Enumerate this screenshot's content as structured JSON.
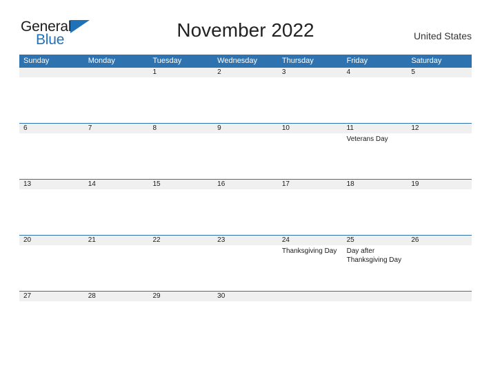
{
  "brand": {
    "line1": "General",
    "line2": "Blue",
    "triangle_color": "#2071b8",
    "text_color": "#1c1c1c"
  },
  "header": {
    "title": "November 2022",
    "country": "United States"
  },
  "theme": {
    "header_blue": "#2e73b0",
    "date_strip": "#f0f0f0",
    "rule_blue": "#2e73b0",
    "page_background": "#ffffff"
  },
  "calendar": {
    "month": "November",
    "year": "2022",
    "weekday_headers": [
      "Sunday",
      "Monday",
      "Tuesday",
      "Wednesday",
      "Thursday",
      "Friday",
      "Saturday"
    ],
    "weeks": [
      [
        {
          "day": "",
          "event": ""
        },
        {
          "day": "",
          "event": ""
        },
        {
          "day": "1",
          "event": ""
        },
        {
          "day": "2",
          "event": ""
        },
        {
          "day": "3",
          "event": ""
        },
        {
          "day": "4",
          "event": ""
        },
        {
          "day": "5",
          "event": ""
        }
      ],
      [
        {
          "day": "6",
          "event": ""
        },
        {
          "day": "7",
          "event": ""
        },
        {
          "day": "8",
          "event": ""
        },
        {
          "day": "9",
          "event": ""
        },
        {
          "day": "10",
          "event": ""
        },
        {
          "day": "11",
          "event": "Veterans Day"
        },
        {
          "day": "12",
          "event": ""
        }
      ],
      [
        {
          "day": "13",
          "event": ""
        },
        {
          "day": "14",
          "event": ""
        },
        {
          "day": "15",
          "event": ""
        },
        {
          "day": "16",
          "event": ""
        },
        {
          "day": "17",
          "event": ""
        },
        {
          "day": "18",
          "event": ""
        },
        {
          "day": "19",
          "event": ""
        }
      ],
      [
        {
          "day": "20",
          "event": ""
        },
        {
          "day": "21",
          "event": ""
        },
        {
          "day": "22",
          "event": ""
        },
        {
          "day": "23",
          "event": ""
        },
        {
          "day": "24",
          "event": "Thanksgiving Day"
        },
        {
          "day": "25",
          "event": "Day after Thanksgiving Day"
        },
        {
          "day": "26",
          "event": ""
        }
      ],
      [
        {
          "day": "27",
          "event": ""
        },
        {
          "day": "28",
          "event": ""
        },
        {
          "day": "29",
          "event": ""
        },
        {
          "day": "30",
          "event": ""
        },
        {
          "day": "",
          "event": ""
        },
        {
          "day": "",
          "event": ""
        },
        {
          "day": "",
          "event": ""
        }
      ]
    ]
  }
}
